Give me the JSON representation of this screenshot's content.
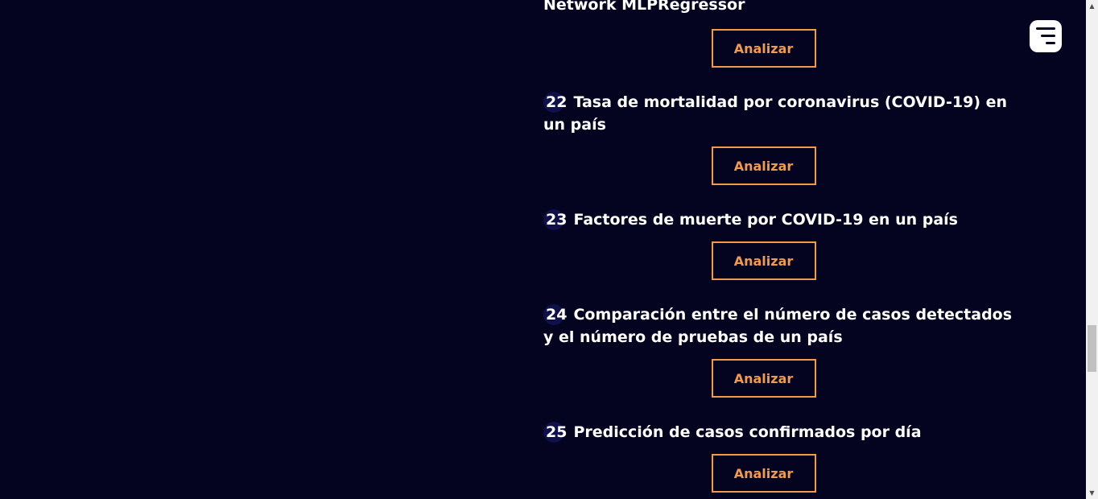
{
  "colors": {
    "background": "#040420",
    "accent": "#f2994a",
    "badge": "#0f0f4a"
  },
  "partial_item": {
    "title_tail": "Network MLPRegressor",
    "button_label": "Analizar"
  },
  "items": [
    {
      "number": "22",
      "title": "Tasa de mortalidad por coronavirus (COVID-19) en un país",
      "button_label": "Analizar"
    },
    {
      "number": "23",
      "title": "Factores de muerte por COVID-19 en un país",
      "button_label": "Analizar"
    },
    {
      "number": "24",
      "title": "Comparación entre el número de casos detectados y el número de pruebas de un país",
      "button_label": "Analizar"
    },
    {
      "number": "25",
      "title": "Predicción de casos confirmados por día",
      "button_label": "Analizar"
    }
  ],
  "header": {
    "menu_icon": "hamburger-menu-icon"
  },
  "scrollbar": {
    "up_icon": "scroll-up-arrow-icon",
    "down_icon": "scroll-down-arrow-icon"
  }
}
